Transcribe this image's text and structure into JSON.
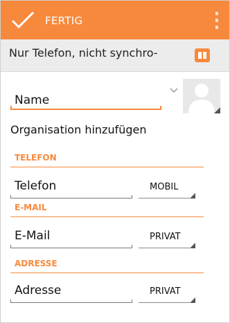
{
  "colors": {
    "accent": "#f7893c",
    "account_bg": "#ececec"
  },
  "action_bar": {
    "done_label": "FERTIG",
    "done_icon": "check-icon",
    "overflow_icon": "overflow-menu-icon"
  },
  "account": {
    "label": "Nur Telefon, nicht synchro-",
    "icon": "address-book-icon"
  },
  "name_field": {
    "value": "Name",
    "expand_icon": "chevron-down-icon",
    "photo_icon": "contact-photo-icon"
  },
  "organization": {
    "label": "Organisation hinzufügen"
  },
  "sections": {
    "phone": {
      "header": "TELEFON",
      "value": "Telefon",
      "type": "MOBIL"
    },
    "email": {
      "header": "E-MAIL",
      "value": "E-Mail",
      "type": "PRIVAT"
    },
    "address": {
      "header": "ADRESSE",
      "value": "Adresse",
      "type": "PRIVAT"
    }
  }
}
